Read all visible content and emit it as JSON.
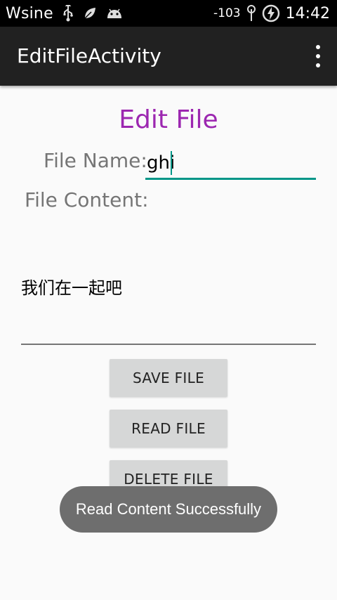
{
  "status_bar": {
    "carrier": "Wsine",
    "icons": [
      "usb-icon",
      "leaf-icon",
      "android-icon"
    ],
    "signal": "-103",
    "time": "14:42"
  },
  "app_bar": {
    "title": "EditFileActivity"
  },
  "form": {
    "heading": "Edit File",
    "file_name_label": "File Name:",
    "file_name_value": "ghi",
    "file_content_label": "File Content:",
    "file_content_value": "我们在一起吧"
  },
  "buttons": {
    "save": "SAVE FILE",
    "read": "READ FILE",
    "delete": "DELETE FILE"
  },
  "toast": {
    "message": "Read Content Successfully"
  },
  "colors": {
    "heading": "#9c27b0",
    "accent": "#009688",
    "app_bar": "#212121"
  }
}
